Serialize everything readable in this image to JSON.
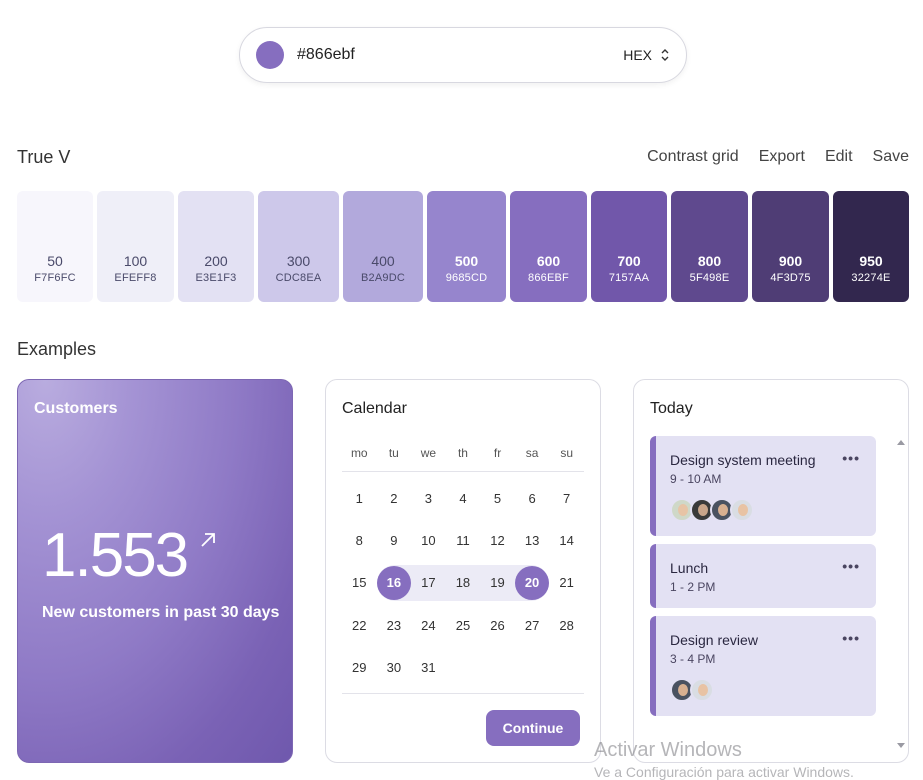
{
  "picker": {
    "value": "#866ebf",
    "format": "HEX",
    "swatch_color": "#866ebf"
  },
  "palette": {
    "name": "True V",
    "actions": [
      "Contrast grid",
      "Export",
      "Edit",
      "Save"
    ],
    "shades": [
      {
        "shade": "50",
        "code": "F7F6FC",
        "color": "#F7F6FC",
        "text": "#4a4a6a"
      },
      {
        "shade": "100",
        "code": "EFEFF8",
        "color": "#EFEFF8",
        "text": "#4a4a6a"
      },
      {
        "shade": "200",
        "code": "E3E1F3",
        "color": "#E3E1F3",
        "text": "#4a4a6a"
      },
      {
        "shade": "300",
        "code": "CDC8EA",
        "color": "#CDC8EA",
        "text": "#4a4a6a"
      },
      {
        "shade": "400",
        "code": "B2A9DC",
        "color": "#B2A9DC",
        "text": "#4a4a6a"
      },
      {
        "shade": "500",
        "code": "9685CD",
        "color": "#9685CD",
        "text": "#ffffff"
      },
      {
        "shade": "600",
        "code": "866EBF",
        "color": "#866EBF",
        "text": "#ffffff"
      },
      {
        "shade": "700",
        "code": "7157AA",
        "color": "#7157AA",
        "text": "#ffffff"
      },
      {
        "shade": "800",
        "code": "5F498E",
        "color": "#5F498E",
        "text": "#ffffff"
      },
      {
        "shade": "900",
        "code": "4F3D75",
        "color": "#4F3D75",
        "text": "#ffffff"
      },
      {
        "shade": "950",
        "code": "32274E",
        "color": "#32274E",
        "text": "#ffffff"
      }
    ]
  },
  "examples": {
    "title": "Examples"
  },
  "customers": {
    "title": "Customers",
    "value": "1.553",
    "subtitle": "New customers in past 30 days"
  },
  "calendar": {
    "title": "Calendar",
    "weekdays": [
      "mo",
      "tu",
      "we",
      "th",
      "fr",
      "sa",
      "su"
    ],
    "weeks": [
      [
        "1",
        "2",
        "3",
        "4",
        "5",
        "6",
        "7"
      ],
      [
        "8",
        "9",
        "10",
        "11",
        "12",
        "13",
        "14"
      ],
      [
        "15",
        "16",
        "17",
        "18",
        "19",
        "20",
        "21"
      ],
      [
        "22",
        "23",
        "24",
        "25",
        "26",
        "27",
        "28"
      ],
      [
        "29",
        "30",
        "31",
        "",
        "",
        "",
        ""
      ]
    ],
    "range_start": "16",
    "range_end": "20",
    "continue_label": "Continue"
  },
  "today": {
    "title": "Today",
    "events": [
      {
        "title": "Design system meeting",
        "time": "9 - 10 AM",
        "more": "•••",
        "attendees": 4
      },
      {
        "title": "Lunch",
        "time": "1 - 2 PM",
        "more": "•••",
        "attendees": 0
      },
      {
        "title": "Design review",
        "time": "3 - 4 PM",
        "more": "•••",
        "attendees": 2
      }
    ]
  },
  "watermark": {
    "line1": "Activar Windows",
    "line2": "Ve a Configuración para activar Windows."
  }
}
